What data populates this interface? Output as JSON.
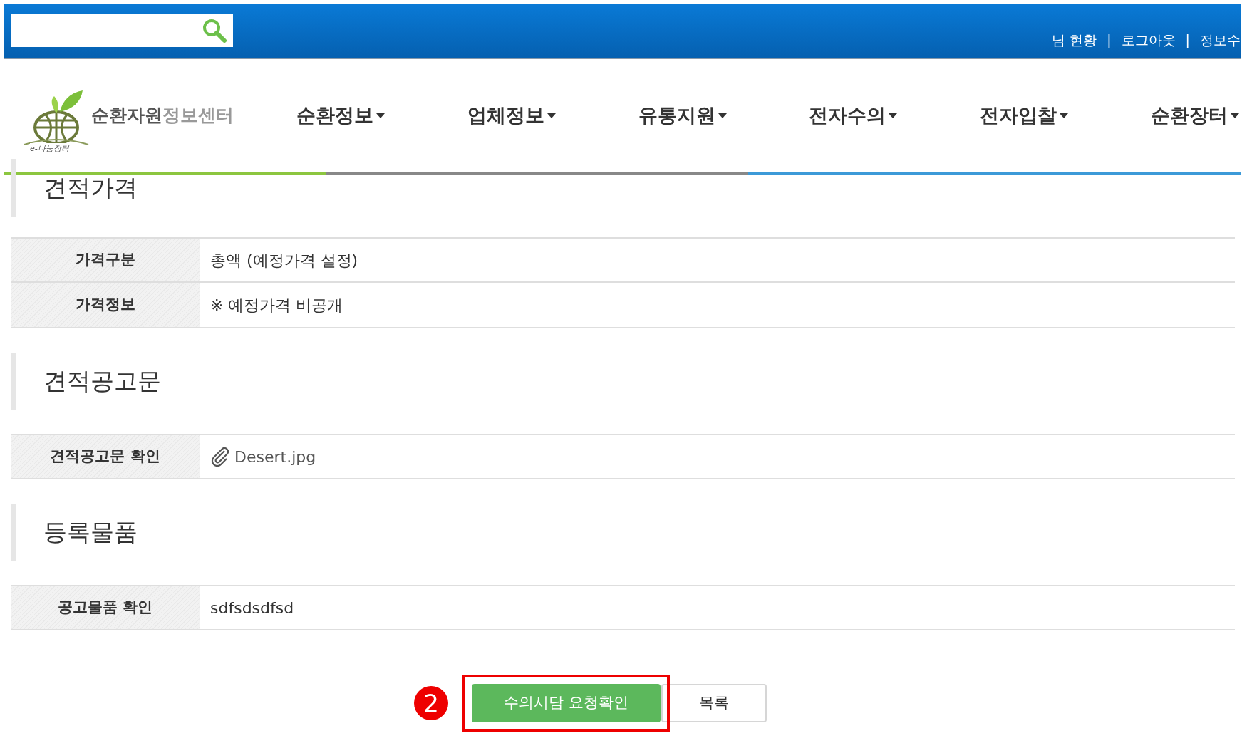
{
  "header": {
    "links": [
      {
        "label": "님 현황"
      },
      {
        "label": "로그아웃"
      },
      {
        "label": "정보수"
      }
    ],
    "separator": "|"
  },
  "logo": {
    "title_main": "순환자원",
    "title_sub": "정보센터",
    "tagline": "e-나눔장터"
  },
  "nav": [
    {
      "label": "순환정보"
    },
    {
      "label": "업체정보"
    },
    {
      "label": "유통지원"
    },
    {
      "label": "전자수의"
    },
    {
      "label": "전자입찰"
    },
    {
      "label": "순환장터"
    }
  ],
  "sections": [
    {
      "title": "견적가격",
      "rows": [
        {
          "label": "가격구분",
          "value": "총액 (예정가격 설정)",
          "kind": "text"
        },
        {
          "label": "가격정보",
          "value": "※ 예정가격 비공개",
          "kind": "text"
        }
      ]
    },
    {
      "title": "견적공고문",
      "rows": [
        {
          "label": "견적공고문 확인",
          "value": "Desert.jpg",
          "kind": "file"
        }
      ]
    },
    {
      "title": "등록물품",
      "rows": [
        {
          "label": "공고물품 확인",
          "value": "sdfsdsdfsd",
          "kind": "text"
        }
      ]
    }
  ],
  "actions": {
    "step": "2",
    "buttons": [
      {
        "label": "수의시담 요청확인",
        "kind": "primary",
        "highlighted": true
      },
      {
        "label": "목록",
        "kind": "secondary",
        "highlighted": false
      }
    ]
  }
}
